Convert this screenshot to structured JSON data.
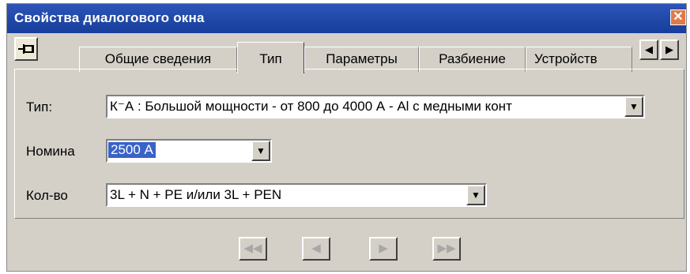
{
  "window": {
    "title": "Свойства диалогового окна",
    "close_glyph": "✕"
  },
  "tabs": [
    {
      "label": "Общие сведения",
      "active": false
    },
    {
      "label": "Тип",
      "active": true
    },
    {
      "label": "Параметры",
      "active": false
    },
    {
      "label": "Разбиение",
      "active": false
    },
    {
      "label": "Устройств",
      "active": false
    }
  ],
  "tab_scroll": {
    "left": "◀",
    "right": "▶"
  },
  "fields": {
    "type": {
      "label": "Тип:",
      "value": "К⁻А : Большой мощности - от 800 до 4000 А - Al с медными конт"
    },
    "rating": {
      "label": "Номина",
      "value": "2500 А"
    },
    "poles": {
      "label": "Кол-во",
      "value": "3L + N + PE и/или 3L + PEN"
    }
  },
  "combo_arrow": "▼",
  "navigation": {
    "first": "◀◀",
    "prev": "◀",
    "next": "▶",
    "last": "▶▶"
  },
  "colors": {
    "titlebar": "#2149a8",
    "dialog_bg": "#d4d0c8",
    "selection": "#3a63c8"
  }
}
